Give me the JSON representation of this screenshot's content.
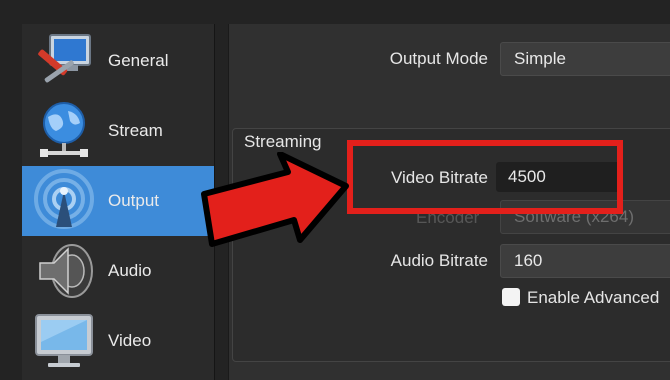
{
  "sidebar": {
    "items": [
      {
        "label": "General",
        "icon": "wrench-screwdriver-monitor-icon"
      },
      {
        "label": "Stream",
        "icon": "globe-network-icon"
      },
      {
        "label": "Output",
        "icon": "broadcast-antenna-icon",
        "selected": true
      },
      {
        "label": "Audio",
        "icon": "speaker-icon"
      },
      {
        "label": "Video",
        "icon": "monitor-icon"
      }
    ]
  },
  "main": {
    "output_mode": {
      "label": "Output Mode",
      "value": "Simple"
    },
    "streaming": {
      "title": "Streaming",
      "video_bitrate": {
        "label": "Video Bitrate",
        "value": "4500"
      },
      "encoder": {
        "label": "Encoder",
        "value": "Software (x264)"
      },
      "audio_bitrate": {
        "label": "Audio Bitrate",
        "value": "160"
      },
      "enable_advanced": {
        "label": "Enable Advanced"
      }
    }
  },
  "colors": {
    "selection": "#3e8bd8",
    "highlight_red": "#e3201b"
  }
}
